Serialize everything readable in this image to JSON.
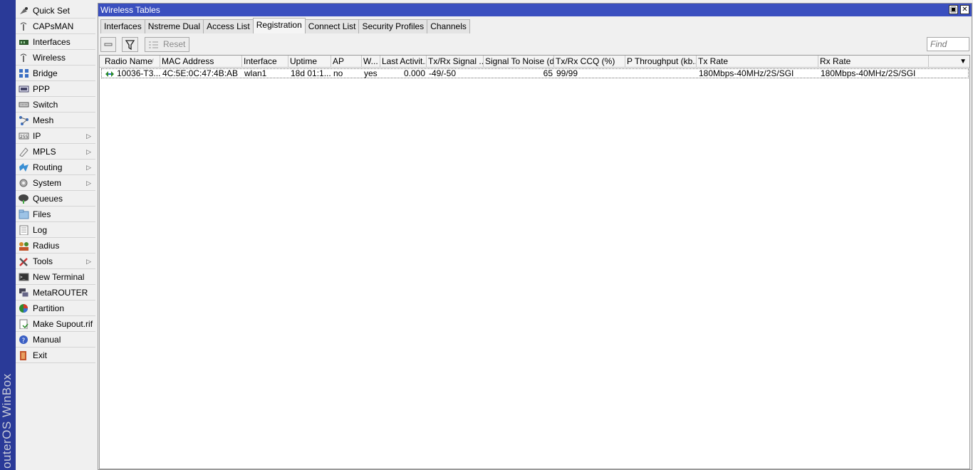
{
  "brand": "outerOS WinBox",
  "sidebar": {
    "items": [
      {
        "label": "Quick Set",
        "icon": "quick-set-icon",
        "submenu": false
      },
      {
        "label": "CAPsMAN",
        "icon": "capsman-icon",
        "submenu": false
      },
      {
        "label": "Interfaces",
        "icon": "interfaces-icon",
        "submenu": false
      },
      {
        "label": "Wireless",
        "icon": "wireless-icon",
        "submenu": false
      },
      {
        "label": "Bridge",
        "icon": "bridge-icon",
        "submenu": false
      },
      {
        "label": "PPP",
        "icon": "ppp-icon",
        "submenu": false
      },
      {
        "label": "Switch",
        "icon": "switch-icon",
        "submenu": false
      },
      {
        "label": "Mesh",
        "icon": "mesh-icon",
        "submenu": false
      },
      {
        "label": "IP",
        "icon": "ip-icon",
        "submenu": true
      },
      {
        "label": "MPLS",
        "icon": "mpls-icon",
        "submenu": true
      },
      {
        "label": "Routing",
        "icon": "routing-icon",
        "submenu": true
      },
      {
        "label": "System",
        "icon": "system-icon",
        "submenu": true
      },
      {
        "label": "Queues",
        "icon": "queues-icon",
        "submenu": false
      },
      {
        "label": "Files",
        "icon": "files-icon",
        "submenu": false
      },
      {
        "label": "Log",
        "icon": "log-icon",
        "submenu": false
      },
      {
        "label": "Radius",
        "icon": "radius-icon",
        "submenu": false
      },
      {
        "label": "Tools",
        "icon": "tools-icon",
        "submenu": true
      },
      {
        "label": "New Terminal",
        "icon": "terminal-icon",
        "submenu": false
      },
      {
        "label": "MetaROUTER",
        "icon": "metarouter-icon",
        "submenu": false
      },
      {
        "label": "Partition",
        "icon": "partition-icon",
        "submenu": false
      },
      {
        "label": "Make Supout.rif",
        "icon": "supout-icon",
        "submenu": false
      },
      {
        "label": "Manual",
        "icon": "manual-icon",
        "submenu": false
      },
      {
        "label": "Exit",
        "icon": "exit-icon",
        "submenu": false
      }
    ]
  },
  "window": {
    "title": "Wireless Tables",
    "tabs": [
      "Interfaces",
      "Nstreme Dual",
      "Access List",
      "Registration",
      "Connect List",
      "Security Profiles",
      "Channels"
    ],
    "active_tab": "Registration",
    "toolbar": {
      "reset_label": "Reset",
      "find_placeholder": "Find"
    },
    "table": {
      "columns": [
        "Radio Name",
        "MAC Address",
        "Interface",
        "Uptime",
        "AP",
        "W...",
        "Last Activit...",
        "Tx/Rx Signal ...",
        "Signal To Noise (d...",
        "Tx/Rx CCQ (%)",
        "P Throughput (kb...",
        "Tx Rate",
        "Rx Rate"
      ],
      "rows": [
        [
          "10036-T3...",
          "4C:5E:0C:47:4B:AB",
          "wlan1",
          "18d 01:1...",
          "no",
          "yes",
          "0.000",
          "-49/-50",
          "65",
          "99/99",
          "",
          "180Mbps-40MHz/2S/SGI",
          "180Mbps-40MHz/2S/SGI"
        ]
      ]
    }
  },
  "colors": {
    "title_bar": "#3a4fbf",
    "brand_strip": "#2a3a98"
  }
}
